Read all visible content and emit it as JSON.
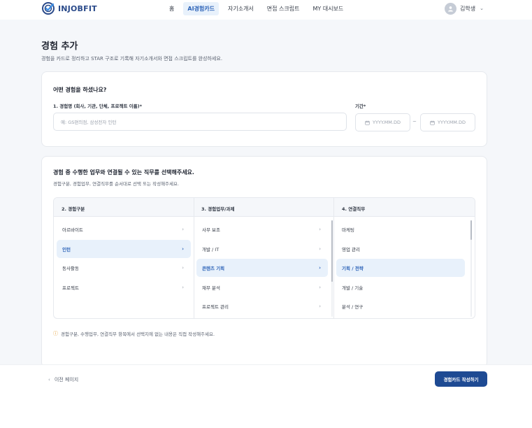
{
  "header": {
    "logo_text": "INJOBFIT",
    "nav": [
      {
        "label": "홈",
        "active": false
      },
      {
        "label": "AI경험카드",
        "active": true
      },
      {
        "label": "자기소개서",
        "active": false
      },
      {
        "label": "면접 스크립트",
        "active": false
      },
      {
        "label": "MY 대시보드",
        "active": false
      }
    ],
    "user_name": "김학생"
  },
  "page": {
    "title": "경험 추가",
    "subtitle": "경험을 카드로 정리하고 STAR 구조로 기록해 자기소개서와 면접 스크립트를 완성하세요."
  },
  "experience_form": {
    "heading": "어떤 경험을 하셨나요?",
    "name_label": "1. 경험명 (회사, 기관, 단체, 프로젝트 이름)*",
    "name_placeholder": "예: GS편의점, 삼성전자 인턴",
    "period_label": "기간*",
    "date_start_placeholder": "YYYY.MM.DD",
    "date_end_placeholder": "YYYY.MM.DD",
    "date_separator": "~"
  },
  "job_selection": {
    "heading": "경험 중 수행한 업무와 연결될 수 있는 직무를 선택해주세요.",
    "subtitle": "경험구분, 경험업무, 연결직무를 순서대로 선택 또는 작성해주세요.",
    "columns": [
      {
        "header": "2. 경험구분",
        "items": [
          {
            "label": "아르바이트",
            "selected": false
          },
          {
            "label": "인턴",
            "selected": true
          },
          {
            "label": "동사활동",
            "selected": false
          },
          {
            "label": "프로젝트",
            "selected": false
          }
        ]
      },
      {
        "header": "3. 경험업무/과제",
        "items": [
          {
            "label": "사무 보조",
            "selected": false
          },
          {
            "label": "개발 / IT",
            "selected": false
          },
          {
            "label": "콘텐츠 기획",
            "selected": true
          },
          {
            "label": "재무 분석",
            "selected": false
          },
          {
            "label": "프로젝트 관리",
            "selected": false
          }
        ]
      },
      {
        "header": "4. 연결직무",
        "items": [
          {
            "label": "마케팅",
            "selected": false
          },
          {
            "label": "영업 관리",
            "selected": false
          },
          {
            "label": "기획 / 전략",
            "selected": true
          },
          {
            "label": "개발 / 기술",
            "selected": false
          },
          {
            "label": "분석 / 연구",
            "selected": false
          }
        ]
      }
    ],
    "notice": "경험구분, 수행업무, 연결직무 항목에서 선택지에 없는 내용은 직접 작성해주세요."
  },
  "footer": {
    "back_label": "이전 페이지",
    "submit_label": "경험카드 작성하기"
  },
  "colors": {
    "brand": "#1e4a93",
    "accent": "#2c63b8",
    "selected_bg": "#e8f1fb",
    "page_bg": "#f5f7fa"
  },
  "icons": {
    "logo": "target-check-icon",
    "avatar": "user-icon",
    "calendar": "calendar-icon",
    "chevron": "chevron-right-icon",
    "info": "info-icon"
  }
}
